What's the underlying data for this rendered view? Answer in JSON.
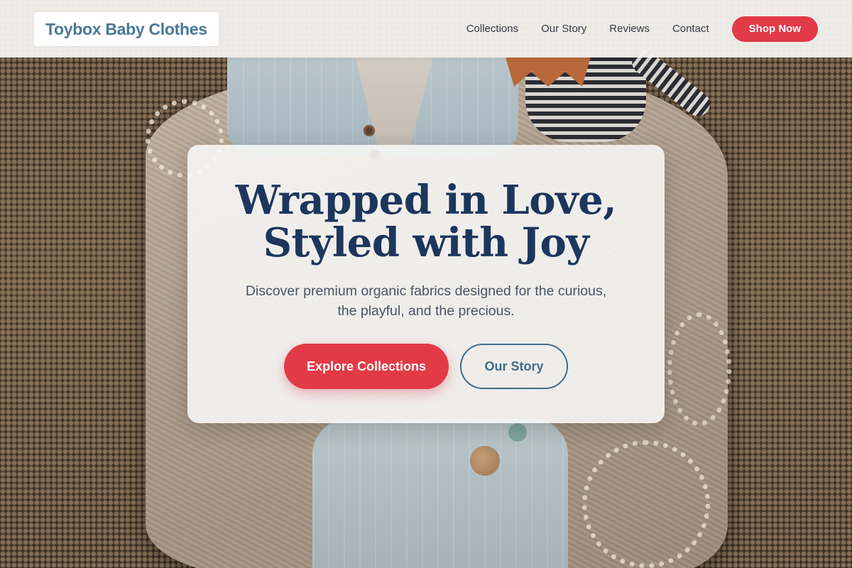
{
  "brand": {
    "name": "Toybox Baby Clothes"
  },
  "nav": {
    "links": [
      "Collections",
      "Our Story",
      "Reviews",
      "Contact"
    ],
    "cta": "Shop Now"
  },
  "hero": {
    "title_line1": "Wrapped in Love,",
    "title_line2": "Styled with Joy",
    "subtitle_line1": "Discover premium organic fabrics designed for the curious,",
    "subtitle_line2": "the playful, and the precious.",
    "primary_button": "Explore Collections",
    "secondary_button": "Our Story"
  },
  "colors": {
    "accent": "#e23a47",
    "heading": "#1d365d",
    "brand_blue": "#4a7896",
    "outline_blue": "#3f6b8a"
  }
}
